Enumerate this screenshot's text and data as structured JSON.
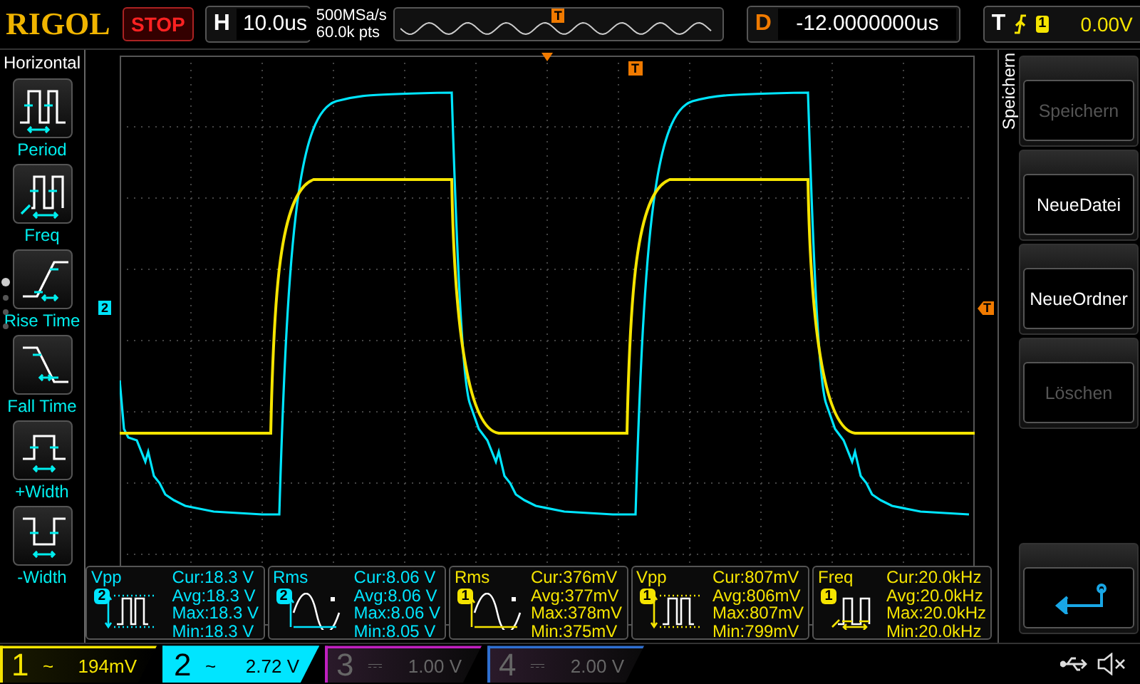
{
  "top_bar": {
    "logo": "RIGOL",
    "run_state": "STOP",
    "horizontal": {
      "label": "H",
      "timebase": "10.0us"
    },
    "sample_rate": "500MSa/s",
    "memory_depth": "60.0k pts",
    "trigger_position_marker": "T",
    "delay": {
      "label": "D",
      "value": "-12.0000000us"
    },
    "trigger": {
      "label": "T",
      "source": "1",
      "threshold": "0.00V"
    }
  },
  "measure_menu": {
    "title": "Horizontal",
    "items": [
      {
        "kind": "period",
        "label": "Period"
      },
      {
        "kind": "freq",
        "label": "Freq"
      },
      {
        "kind": "rise",
        "label": "Rise Time"
      },
      {
        "kind": "fall",
        "label": "Fall Time"
      },
      {
        "kind": "pwidth",
        "label": "+Width"
      },
      {
        "kind": "nwidth",
        "label": "-Width"
      }
    ],
    "pages": [
      {
        "selected": true
      },
      {
        "selected": false
      },
      {
        "selected": false
      },
      {
        "selected": false
      }
    ]
  },
  "screen": {
    "channel_marker": "2",
    "trigger_level_marker": "T",
    "trigger_time_marker": "T",
    "measurements": [
      {
        "kind": "vpp",
        "name": "Vpp",
        "source": "2",
        "color": "#00e5ff",
        "cur": "Cur:18.3 V",
        "avg": "Avg:18.3 V",
        "max": "Max:18.3 V",
        "min": "Min:18.3 V"
      },
      {
        "kind": "rms",
        "name": "Rms",
        "source": "2",
        "color": "#00e5ff",
        "cur": "Cur:8.06 V",
        "avg": "Avg:8.06 V",
        "max": "Max:8.06 V",
        "min": "Min:8.05 V"
      },
      {
        "kind": "rms",
        "name": "Rms",
        "source": "1",
        "color": "#f5e400",
        "cur": "Cur:376mV",
        "avg": "Avg:377mV",
        "max": "Max:378mV",
        "min": "Min:375mV"
      },
      {
        "kind": "vpp",
        "name": "Vpp",
        "source": "1",
        "color": "#f5e400",
        "cur": "Cur:807mV",
        "avg": "Avg:806mV",
        "max": "Max:807mV",
        "min": "Min:799mV"
      },
      {
        "kind": "freq",
        "name": "Freq",
        "source": "1",
        "color": "#f5e400",
        "cur": "Cur:20.0kHz",
        "avg": "Avg:20.0kHz",
        "max": "Max:20.0kHz",
        "min": "Min:20.0kHz"
      }
    ]
  },
  "soft_menu": {
    "title": "Speichern",
    "buttons": [
      {
        "kind": "text",
        "label": "Speichern",
        "disabled": true
      },
      {
        "kind": "text",
        "label": "NeueDatei",
        "disabled": false
      },
      {
        "kind": "text",
        "label": "NeueOrdner",
        "disabled": false
      },
      {
        "kind": "text",
        "label": "Löschen",
        "disabled": true
      },
      {
        "kind": "blank"
      },
      {
        "kind": "back"
      }
    ]
  },
  "channel_bar": [
    {
      "number": "1",
      "coupling": "~",
      "scale": "194mV",
      "enabled": true,
      "selected": false,
      "color": "#f5e400"
    },
    {
      "number": "2",
      "coupling": "~",
      "scale": "2.72 V",
      "enabled": true,
      "selected": true,
      "color": "#00e5ff"
    },
    {
      "number": "3",
      "coupling": "⎓",
      "scale": "1.00 V",
      "enabled": false,
      "selected": false,
      "color": "#c020c0"
    },
    {
      "number": "4",
      "coupling": "⎓",
      "scale": "2.00 V",
      "enabled": false,
      "selected": false,
      "color": "#2f6fd0"
    }
  ]
}
